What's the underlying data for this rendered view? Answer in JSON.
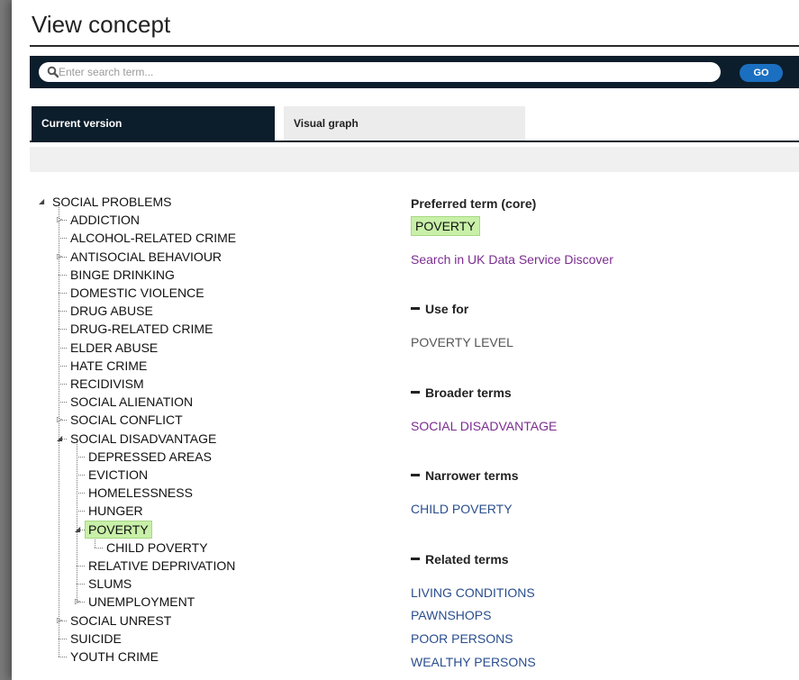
{
  "page": {
    "title": "View concept"
  },
  "search": {
    "placeholder": "Enter search term...",
    "value": "",
    "go_label": "GO"
  },
  "tabs": [
    {
      "label": "Current version",
      "active": true
    },
    {
      "label": "Visual graph",
      "active": false
    }
  ],
  "tree": [
    {
      "label": "SOCIAL PROBLEMS",
      "level": 0,
      "expander": "expanded"
    },
    {
      "label": "ADDICTION",
      "level": 1,
      "expander": "collapsed"
    },
    {
      "label": "ALCOHOL-RELATED CRIME",
      "level": 1,
      "expander": "none"
    },
    {
      "label": "ANTISOCIAL BEHAVIOUR",
      "level": 1,
      "expander": "collapsed"
    },
    {
      "label": "BINGE DRINKING",
      "level": 1,
      "expander": "none"
    },
    {
      "label": "DOMESTIC VIOLENCE",
      "level": 1,
      "expander": "none"
    },
    {
      "label": "DRUG ABUSE",
      "level": 1,
      "expander": "none"
    },
    {
      "label": "DRUG-RELATED CRIME",
      "level": 1,
      "expander": "none"
    },
    {
      "label": "ELDER ABUSE",
      "level": 1,
      "expander": "none"
    },
    {
      "label": "HATE CRIME",
      "level": 1,
      "expander": "none"
    },
    {
      "label": "RECIDIVISM",
      "level": 1,
      "expander": "none"
    },
    {
      "label": "SOCIAL ALIENATION",
      "level": 1,
      "expander": "none"
    },
    {
      "label": "SOCIAL CONFLICT",
      "level": 1,
      "expander": "collapsed"
    },
    {
      "label": "SOCIAL DISADVANTAGE",
      "level": 1,
      "expander": "expanded"
    },
    {
      "label": "DEPRESSED AREAS",
      "level": 2,
      "expander": "none"
    },
    {
      "label": "EVICTION",
      "level": 2,
      "expander": "none"
    },
    {
      "label": "HOMELESSNESS",
      "level": 2,
      "expander": "none"
    },
    {
      "label": "HUNGER",
      "level": 2,
      "expander": "none"
    },
    {
      "label": "POVERTY",
      "level": 2,
      "expander": "expanded",
      "selected": true
    },
    {
      "label": "CHILD POVERTY",
      "level": 3,
      "expander": "none"
    },
    {
      "label": "RELATIVE DEPRIVATION",
      "level": 2,
      "expander": "none"
    },
    {
      "label": "SLUMS",
      "level": 2,
      "expander": "none"
    },
    {
      "label": "UNEMPLOYMENT",
      "level": 2,
      "expander": "collapsed"
    },
    {
      "label": "SOCIAL UNREST",
      "level": 1,
      "expander": "collapsed"
    },
    {
      "label": "SUICIDE",
      "level": 1,
      "expander": "none"
    },
    {
      "label": "YOUTH CRIME",
      "level": 1,
      "expander": "none"
    }
  ],
  "details": {
    "preferred_label": "Preferred term (core)",
    "preferred_value": "POVERTY",
    "search_link": "Search in UK Data Service Discover",
    "use_for_label": "Use for",
    "use_for": [
      "POVERTY LEVEL"
    ],
    "broader_label": "Broader terms",
    "broader": [
      "SOCIAL DISADVANTAGE"
    ],
    "narrower_label": "Narrower terms",
    "narrower": [
      "CHILD POVERTY"
    ],
    "related_label": "Related terms",
    "related": [
      "LIVING CONDITIONS",
      "PAWNSHOPS",
      "POOR PERSONS",
      "WEALTHY PERSONS"
    ]
  },
  "colors": {
    "accent_dark": "#0c1d2b",
    "go_button": "#1b6fc1",
    "highlight": "#c8f0a8",
    "link_purple": "#7b2c8f",
    "link_blue": "#2a4e8e"
  },
  "icons": {
    "search": "search-icon"
  }
}
